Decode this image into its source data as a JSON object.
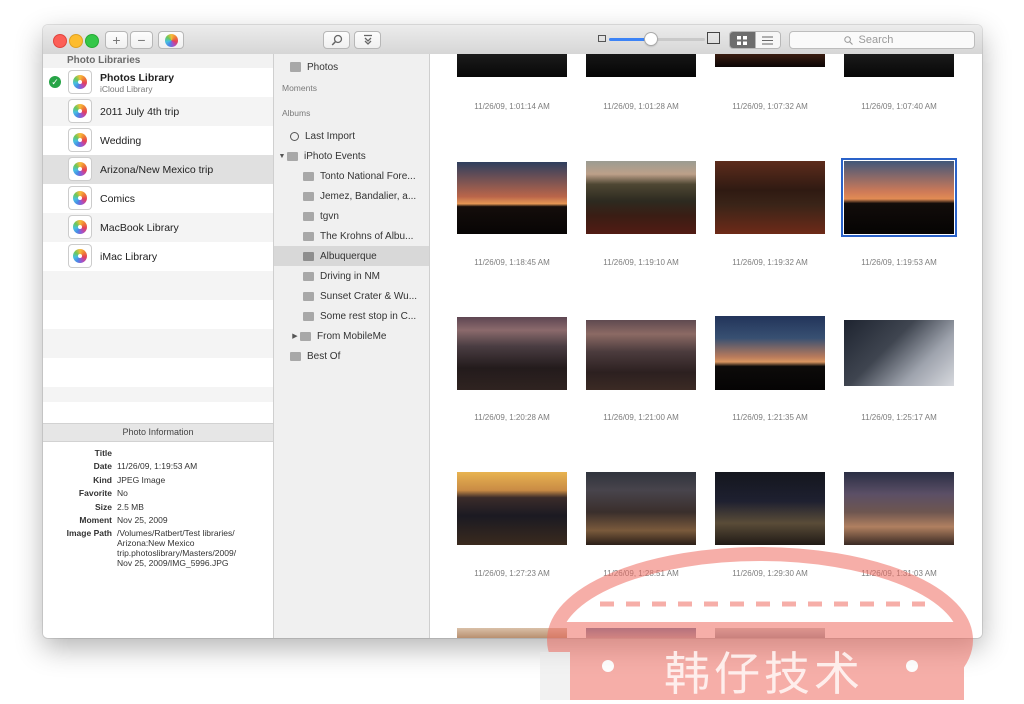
{
  "toolbar": {
    "add_label": "+",
    "remove_label": "−",
    "zoom_level": 0.44,
    "search_placeholder": "Search"
  },
  "libraries": {
    "header": "Photo Libraries",
    "items": [
      {
        "name": "Photos Library",
        "subtitle": "iCloud Library"
      },
      {
        "name": "2011 July 4th trip"
      },
      {
        "name": "Wedding"
      },
      {
        "name": "Arizona/New Mexico trip"
      },
      {
        "name": "Comics"
      },
      {
        "name": "MacBook Library"
      },
      {
        "name": "iMac Library"
      }
    ]
  },
  "info": {
    "title": "Photo Information",
    "title_label": "Title",
    "date_label": "Date",
    "date_value": "11/26/09, 1:19:53 AM",
    "kind_label": "Kind",
    "kind_value": "JPEG Image",
    "favorite_label": "Favorite",
    "favorite_value": "No",
    "size_label": "Size",
    "size_value": "2.5 MB",
    "moment_label": "Moment",
    "moment_value": "Nov 25, 2009",
    "path_label": "Image Path",
    "path_line1": "/Volumes/Ratbert/Test libraries/",
    "path_line2": "Arizona:New Mexico",
    "path_line3": "trip.photoslibrary/Masters/2009/",
    "path_line4": "Nov 25, 2009/IMG_5996.JPG"
  },
  "albums": {
    "photos": "Photos",
    "moments": "Moments",
    "albums_header": "Albums",
    "last_import": "Last Import",
    "iphoto_events": "iPhoto Events",
    "events": [
      "Tonto National Fore...",
      "Jemez, Bandalier, a...",
      "tgvn",
      "The Krohns of Albu...",
      "Albuquerque",
      "Driving in NM",
      "Sunset Crater & Wu...",
      "Some rest stop in C...",
      "From MobileMe"
    ],
    "best_of": "Best Of"
  },
  "grid": {
    "rows": [
      [
        "11/26/09, 1:01:14 AM",
        "11/26/09, 1:01:28 AM",
        "11/26/09, 1:07:32 AM",
        "11/26/09, 1:07:40 AM"
      ],
      [
        "11/26/09, 1:18:45 AM",
        "11/26/09, 1:19:10 AM",
        "11/26/09, 1:19:32 AM",
        "11/26/09, 1:19:53 AM"
      ],
      [
        "11/26/09, 1:20:28 AM",
        "11/26/09, 1:21:00 AM",
        "11/26/09, 1:21:35 AM",
        "11/26/09, 1:25:17 AM"
      ],
      [
        "11/26/09, 1:27:23 AM",
        "11/26/09, 1:28:51 AM",
        "11/26/09, 1:29:30 AM",
        "11/26/09, 1:31:03 AM"
      ]
    ]
  },
  "watermark": {
    "text": "韩仔技术"
  }
}
